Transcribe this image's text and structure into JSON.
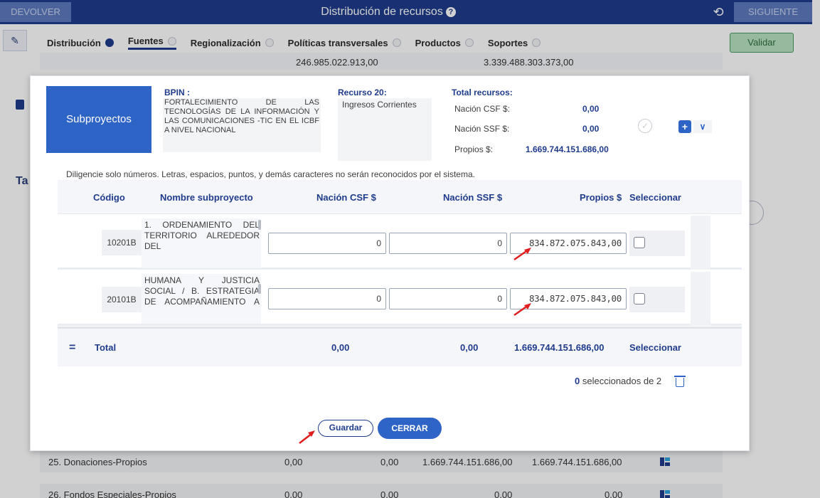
{
  "app": {
    "title": "Distribución de recursos",
    "devolver_label": "DEVOLVER",
    "siguiente_label": "SIGUIENTE",
    "validar_label": "Validar",
    "tabs": [
      {
        "label": "Distribución",
        "state": "filled"
      },
      {
        "label": "Fuentes",
        "state": "empty"
      },
      {
        "label": "Regionalización",
        "state": "empty"
      },
      {
        "label": "Políticas transversales",
        "state": "empty"
      },
      {
        "label": "Productos",
        "state": "empty"
      },
      {
        "label": "Soportes",
        "state": "empty"
      }
    ],
    "under_values": [
      "246.985.022.913,00",
      "3.339.488.303.373,00"
    ],
    "side_letter": "Ta",
    "background_rows": [
      {
        "name": "25. Donaciones-Propios",
        "v1": "0,00",
        "v2": "0,00",
        "v3": "1.669.744.151.686,00",
        "v4": "1.669.744.151.686,00"
      },
      {
        "name": "26. Fondos Especiales-Propios",
        "v1": "0,00",
        "v2": "0,00",
        "v3": "0,00",
        "v4": "0,00"
      }
    ]
  },
  "modal": {
    "title": "Subproyectos",
    "bpin_label": "BPIN :",
    "bpin_text": "FORTALECIMIENTO DE LAS TECNOLOGÍAS DE LA INFORMACIÓN Y LAS COMUNICACIONES -TIC EN EL ICBF A NIVEL NACIONAL",
    "recurso_label": "Recurso 20:",
    "recurso_value": "Ingresos Corrientes",
    "total_label": "Total recursos:",
    "totals": [
      {
        "label": "Nación CSF $:",
        "value": "0,00"
      },
      {
        "label": "Nación SSF $:",
        "value": "0,00"
      },
      {
        "label": "Propios $:",
        "value": "1.669.744.151.686,00"
      }
    ],
    "note": "Diligencie solo números. Letras, espacios, puntos, y demás caracteres no serán reconocidos por el sistema.",
    "columns": {
      "codigo": "Código",
      "nombre": "Nombre subproyecto",
      "csf": "Nación CSF $",
      "ssf": "Nación SSF $",
      "propios": "Propios $",
      "seleccionar": "Seleccionar"
    },
    "rows": [
      {
        "code": "10201B",
        "name": "1. ORDENAMIENTO DEL TERRITORIO ALREDEDOR DEL",
        "csf": "0",
        "ssf": "0",
        "propios": "834.872.075.843,00"
      },
      {
        "code": "20101B",
        "name": "HUMANA Y JUSTICIA SOCIAL / B. ESTRATEGIA DE ACOMPAÑAMIENTO A",
        "csf": "0",
        "ssf": "0",
        "propios": "834.872.075.843,00"
      }
    ],
    "footer": {
      "total_label": "Total",
      "csf": "0,00",
      "ssf": "0,00",
      "propios": "1.669.744.151.686,00",
      "seleccionar": "Seleccionar"
    },
    "selected_count": "0",
    "selected_text": "seleccionados de 2",
    "guardar_label": "Guardar",
    "cerrar_label": "CERRAR"
  }
}
